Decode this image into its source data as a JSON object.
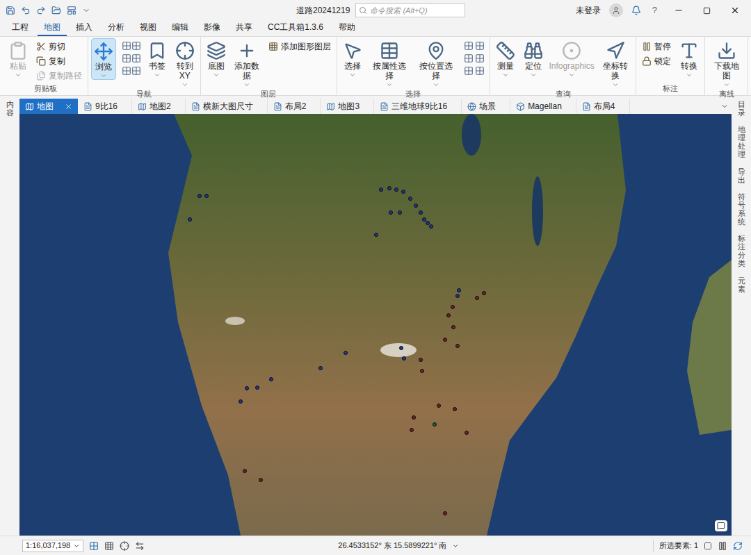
{
  "window": {
    "title": "道路20241219",
    "search_placeholder": "命令搜索 (Alt+Q)",
    "user": "未登录",
    "help": "?"
  },
  "ribbon_tabs": [
    {
      "label": "工程",
      "selected": false
    },
    {
      "label": "地图",
      "selected": true
    },
    {
      "label": "插入",
      "selected": false
    },
    {
      "label": "分析",
      "selected": false
    },
    {
      "label": "视图",
      "selected": false
    },
    {
      "label": "编辑",
      "selected": false
    },
    {
      "label": "影像",
      "selected": false
    },
    {
      "label": "共享",
      "selected": false
    },
    {
      "label": "CC工具箱1.3.6",
      "selected": false
    },
    {
      "label": "帮助",
      "selected": false
    }
  ],
  "ribbon_groups": [
    {
      "label": "剪贴板",
      "buttons": [
        {
          "label": "粘贴",
          "kind": "large",
          "disabled": true,
          "selected": false
        },
        {
          "label": "剪切",
          "kind": "small",
          "disabled": false,
          "selected": false
        },
        {
          "label": "复制",
          "kind": "small",
          "disabled": false,
          "selected": false
        },
        {
          "label": "复制路径",
          "kind": "small",
          "disabled": true,
          "selected": false
        }
      ]
    },
    {
      "label": "导航",
      "buttons": [
        {
          "label": "浏览",
          "kind": "large",
          "disabled": false,
          "selected": true
        },
        {
          "label": "",
          "kind": "grid",
          "disabled": false,
          "selected": false
        },
        {
          "label": "书签",
          "kind": "large",
          "disabled": false,
          "selected": false
        },
        {
          "label": "转到\nXY",
          "kind": "large",
          "disabled": false,
          "selected": false
        }
      ]
    },
    {
      "label": "图层",
      "buttons": [
        {
          "label": "底图",
          "kind": "large",
          "disabled": false,
          "selected": false
        },
        {
          "label": "添加数据",
          "kind": "large",
          "disabled": false,
          "selected": false
        },
        {
          "label": "添加图形图层",
          "kind": "small",
          "disabled": false,
          "selected": false
        }
      ]
    },
    {
      "label": "选择",
      "buttons": [
        {
          "label": "选择",
          "kind": "large",
          "disabled": false,
          "selected": false
        },
        {
          "label": "按属性选择",
          "kind": "large",
          "disabled": false,
          "selected": false
        },
        {
          "label": "按位置选择",
          "kind": "large",
          "disabled": false,
          "selected": false
        },
        {
          "label": "",
          "kind": "grid",
          "disabled": false,
          "selected": false
        }
      ]
    },
    {
      "label": "查询",
      "buttons": [
        {
          "label": "测量",
          "kind": "large",
          "disabled": false,
          "selected": false
        },
        {
          "label": "定位",
          "kind": "large",
          "disabled": false,
          "selected": false
        },
        {
          "label": "Infographics",
          "kind": "large",
          "disabled": true,
          "selected": false
        },
        {
          "label": "坐标转换",
          "kind": "large",
          "disabled": false,
          "selected": false
        }
      ]
    },
    {
      "label": "标注",
      "buttons": [
        {
          "label": "暂停",
          "kind": "small",
          "disabled": false,
          "selected": false
        },
        {
          "label": "锁定",
          "kind": "small",
          "disabled": false,
          "selected": false
        },
        {
          "label": "转换",
          "kind": "large",
          "disabled": false,
          "selected": false
        }
      ]
    },
    {
      "label": "离线",
      "buttons": [
        {
          "label": "下载地图",
          "kind": "large",
          "disabled": false,
          "selected": false
        }
      ]
    }
  ],
  "left_panel": {
    "label": "内容"
  },
  "right_panel": [
    {
      "label": "目录"
    },
    {
      "label": "地理处理"
    },
    {
      "label": "导出"
    },
    {
      "label": "符号系统"
    },
    {
      "label": "标注分类"
    },
    {
      "label": "元素"
    }
  ],
  "doc_tabs": [
    {
      "label": "地图",
      "selected": true,
      "closable": true
    },
    {
      "label": "9比16",
      "selected": false,
      "closable": false
    },
    {
      "label": "地图2",
      "selected": false,
      "closable": false
    },
    {
      "label": "横新大图尺寸",
      "selected": false,
      "closable": false
    },
    {
      "label": "布局2",
      "selected": false,
      "closable": false
    },
    {
      "label": "地图3",
      "selected": false,
      "closable": false
    },
    {
      "label": "三维地球9比16",
      "selected": false,
      "closable": false
    },
    {
      "label": "场景",
      "selected": false,
      "closable": false
    },
    {
      "label": "Magellan",
      "selected": false,
      "closable": false
    },
    {
      "label": "布局4",
      "selected": false,
      "closable": false
    }
  ],
  "map": {
    "pins": [
      {
        "color": "#1e3a8a"
      },
      {
        "color": "#1e3a8a"
      },
      {
        "color": "#1e3a8a"
      },
      {
        "color": "#1e3a8a"
      },
      {
        "color": "#1e3a8a"
      },
      {
        "color": "#1e3a8a"
      },
      {
        "color": "#1e3a8a"
      },
      {
        "color": "#1e3a8a"
      },
      {
        "color": "#1e3a8a"
      },
      {
        "color": "#1e3a8a"
      },
      {
        "color": "#1e3a8a"
      },
      {
        "color": "#1e3a8a"
      },
      {
        "color": "#1e3a8a"
      },
      {
        "color": "#1e3a8a"
      },
      {
        "color": "#1e3a8a"
      },
      {
        "color": "#1e3a8a"
      },
      {
        "color": "#1e3a8a"
      },
      {
        "color": "#1e3a8a"
      },
      {
        "color": "#1e3a8a"
      },
      {
        "color": "#1e3a8a"
      },
      {
        "color": "#1e3a8a"
      },
      {
        "color": "#1e3a8a"
      },
      {
        "color": "#1e3a8a"
      },
      {
        "color": "#1e3a8a"
      },
      {
        "color": "#1e3a8a"
      },
      {
        "color": "#1e3a8a"
      },
      {
        "color": "#7f1d1d"
      },
      {
        "color": "#7f1d1d"
      },
      {
        "color": "#7f1d1d"
      },
      {
        "color": "#7f1d1d"
      },
      {
        "color": "#7f1d1d"
      },
      {
        "color": "#7f1d1d"
      },
      {
        "color": "#7f1d1d"
      },
      {
        "color": "#7f1d1d"
      },
      {
        "color": "#7f1d1d"
      },
      {
        "color": "#7f1d1d"
      },
      {
        "color": "#7f1d1d"
      },
      {
        "color": "#7f1d1d"
      },
      {
        "color": "#7f1d1d"
      },
      {
        "color": "#7f1d1d"
      },
      {
        "color": "#7f1d1d"
      },
      {
        "color": "#7f1d1d"
      },
      {
        "color": "#7f1d1d"
      },
      {
        "color": "#166534"
      }
    ]
  },
  "status_bar": {
    "scale": "1:16,037,198",
    "coordinates": "26.4533152° 东 15.5899221° 南",
    "selected_features": "所选要素: 1"
  }
}
